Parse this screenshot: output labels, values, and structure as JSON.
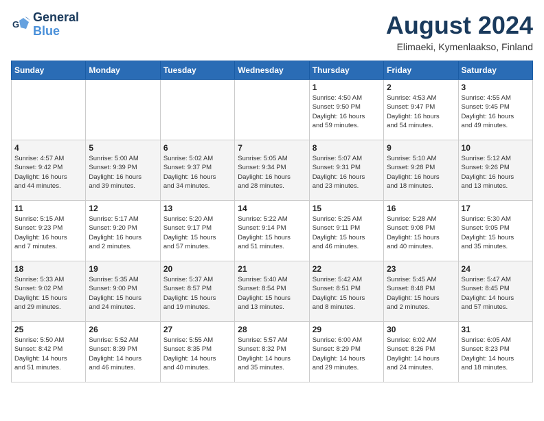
{
  "header": {
    "logo_line1": "General",
    "logo_line2": "Blue",
    "month": "August 2024",
    "location": "Elimaeki, Kymenlaakso, Finland"
  },
  "weekdays": [
    "Sunday",
    "Monday",
    "Tuesday",
    "Wednesday",
    "Thursday",
    "Friday",
    "Saturday"
  ],
  "weeks": [
    [
      {
        "day": "",
        "detail": ""
      },
      {
        "day": "",
        "detail": ""
      },
      {
        "day": "",
        "detail": ""
      },
      {
        "day": "",
        "detail": ""
      },
      {
        "day": "1",
        "detail": "Sunrise: 4:50 AM\nSunset: 9:50 PM\nDaylight: 16 hours\nand 59 minutes."
      },
      {
        "day": "2",
        "detail": "Sunrise: 4:53 AM\nSunset: 9:47 PM\nDaylight: 16 hours\nand 54 minutes."
      },
      {
        "day": "3",
        "detail": "Sunrise: 4:55 AM\nSunset: 9:45 PM\nDaylight: 16 hours\nand 49 minutes."
      }
    ],
    [
      {
        "day": "4",
        "detail": "Sunrise: 4:57 AM\nSunset: 9:42 PM\nDaylight: 16 hours\nand 44 minutes."
      },
      {
        "day": "5",
        "detail": "Sunrise: 5:00 AM\nSunset: 9:39 PM\nDaylight: 16 hours\nand 39 minutes."
      },
      {
        "day": "6",
        "detail": "Sunrise: 5:02 AM\nSunset: 9:37 PM\nDaylight: 16 hours\nand 34 minutes."
      },
      {
        "day": "7",
        "detail": "Sunrise: 5:05 AM\nSunset: 9:34 PM\nDaylight: 16 hours\nand 28 minutes."
      },
      {
        "day": "8",
        "detail": "Sunrise: 5:07 AM\nSunset: 9:31 PM\nDaylight: 16 hours\nand 23 minutes."
      },
      {
        "day": "9",
        "detail": "Sunrise: 5:10 AM\nSunset: 9:28 PM\nDaylight: 16 hours\nand 18 minutes."
      },
      {
        "day": "10",
        "detail": "Sunrise: 5:12 AM\nSunset: 9:26 PM\nDaylight: 16 hours\nand 13 minutes."
      }
    ],
    [
      {
        "day": "11",
        "detail": "Sunrise: 5:15 AM\nSunset: 9:23 PM\nDaylight: 16 hours\nand 7 minutes."
      },
      {
        "day": "12",
        "detail": "Sunrise: 5:17 AM\nSunset: 9:20 PM\nDaylight: 16 hours\nand 2 minutes."
      },
      {
        "day": "13",
        "detail": "Sunrise: 5:20 AM\nSunset: 9:17 PM\nDaylight: 15 hours\nand 57 minutes."
      },
      {
        "day": "14",
        "detail": "Sunrise: 5:22 AM\nSunset: 9:14 PM\nDaylight: 15 hours\nand 51 minutes."
      },
      {
        "day": "15",
        "detail": "Sunrise: 5:25 AM\nSunset: 9:11 PM\nDaylight: 15 hours\nand 46 minutes."
      },
      {
        "day": "16",
        "detail": "Sunrise: 5:28 AM\nSunset: 9:08 PM\nDaylight: 15 hours\nand 40 minutes."
      },
      {
        "day": "17",
        "detail": "Sunrise: 5:30 AM\nSunset: 9:05 PM\nDaylight: 15 hours\nand 35 minutes."
      }
    ],
    [
      {
        "day": "18",
        "detail": "Sunrise: 5:33 AM\nSunset: 9:02 PM\nDaylight: 15 hours\nand 29 minutes."
      },
      {
        "day": "19",
        "detail": "Sunrise: 5:35 AM\nSunset: 9:00 PM\nDaylight: 15 hours\nand 24 minutes."
      },
      {
        "day": "20",
        "detail": "Sunrise: 5:37 AM\nSunset: 8:57 PM\nDaylight: 15 hours\nand 19 minutes."
      },
      {
        "day": "21",
        "detail": "Sunrise: 5:40 AM\nSunset: 8:54 PM\nDaylight: 15 hours\nand 13 minutes."
      },
      {
        "day": "22",
        "detail": "Sunrise: 5:42 AM\nSunset: 8:51 PM\nDaylight: 15 hours\nand 8 minutes."
      },
      {
        "day": "23",
        "detail": "Sunrise: 5:45 AM\nSunset: 8:48 PM\nDaylight: 15 hours\nand 2 minutes."
      },
      {
        "day": "24",
        "detail": "Sunrise: 5:47 AM\nSunset: 8:45 PM\nDaylight: 14 hours\nand 57 minutes."
      }
    ],
    [
      {
        "day": "25",
        "detail": "Sunrise: 5:50 AM\nSunset: 8:42 PM\nDaylight: 14 hours\nand 51 minutes."
      },
      {
        "day": "26",
        "detail": "Sunrise: 5:52 AM\nSunset: 8:39 PM\nDaylight: 14 hours\nand 46 minutes."
      },
      {
        "day": "27",
        "detail": "Sunrise: 5:55 AM\nSunset: 8:35 PM\nDaylight: 14 hours\nand 40 minutes."
      },
      {
        "day": "28",
        "detail": "Sunrise: 5:57 AM\nSunset: 8:32 PM\nDaylight: 14 hours\nand 35 minutes."
      },
      {
        "day": "29",
        "detail": "Sunrise: 6:00 AM\nSunset: 8:29 PM\nDaylight: 14 hours\nand 29 minutes."
      },
      {
        "day": "30",
        "detail": "Sunrise: 6:02 AM\nSunset: 8:26 PM\nDaylight: 14 hours\nand 24 minutes."
      },
      {
        "day": "31",
        "detail": "Sunrise: 6:05 AM\nSunset: 8:23 PM\nDaylight: 14 hours\nand 18 minutes."
      }
    ]
  ]
}
